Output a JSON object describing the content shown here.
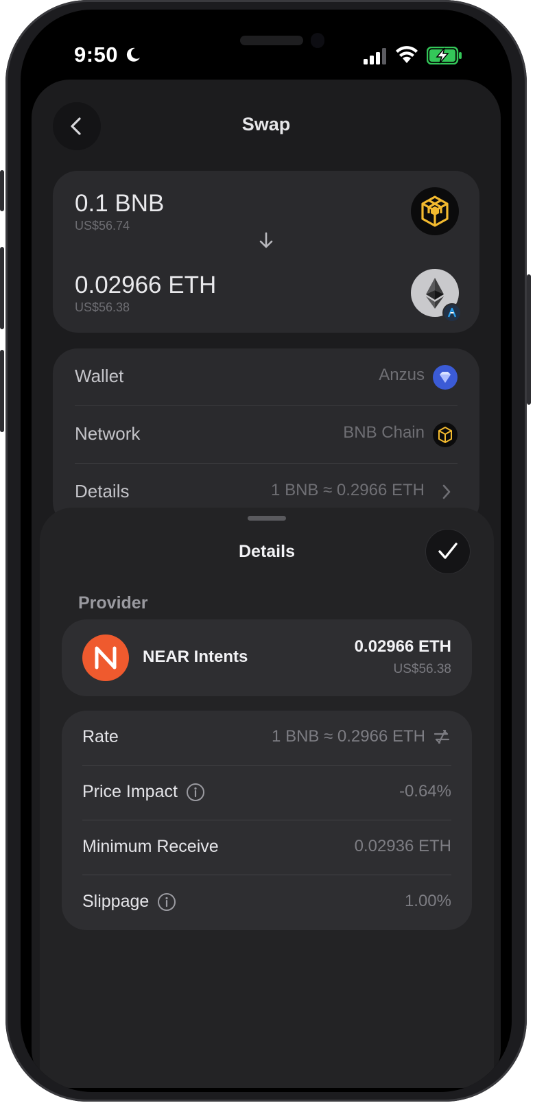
{
  "status_bar": {
    "time": "9:50"
  },
  "header": {
    "title": "Swap"
  },
  "swap": {
    "from_amount": "0.1 BNB",
    "from_usd": "US$56.74",
    "to_amount": "0.02966 ETH",
    "to_usd": "US$56.38"
  },
  "info": {
    "wallet_label": "Wallet",
    "wallet_value": "Anzus",
    "network_label": "Network",
    "network_value": "BNB Chain",
    "details_label": "Details",
    "details_value": "1 BNB ≈ 0.2966 ETH"
  },
  "sheet": {
    "title": "Details",
    "provider_section": "Provider",
    "provider": {
      "name": "NEAR Intents",
      "amount": "0.02966 ETH",
      "usd": "US$56.38"
    },
    "rows": {
      "rate_label": "Rate",
      "rate_value": "1 BNB ≈ 0.2966 ETH",
      "impact_label": "Price Impact",
      "impact_value": "-0.64%",
      "min_label": "Minimum Receive",
      "min_value": "0.02936 ETH",
      "slippage_label": "Slippage",
      "slippage_value": "1.00%"
    }
  },
  "colors": {
    "bnb": "#f3ba2f",
    "eth_bg": "#c9c9cc",
    "near": "#ef5a2e",
    "wallet_blue": "#3b5bd6"
  }
}
